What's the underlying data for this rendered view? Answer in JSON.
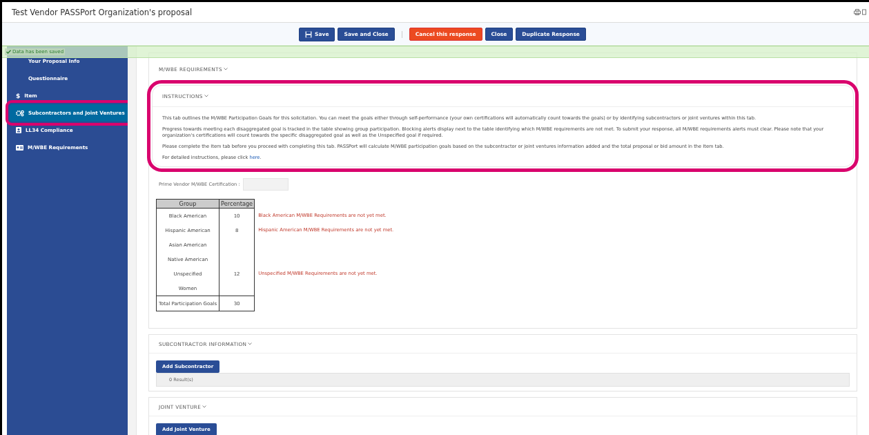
{
  "window": {
    "title": "Test Vendor PASSPort Organization's proposal"
  },
  "toolbar": {
    "buttons": [
      {
        "label": "Save",
        "kind": "primary"
      },
      {
        "label": "Save and Close",
        "kind": "primary"
      },
      {
        "kind": "separator"
      },
      {
        "label": "Cancel this response",
        "kind": "danger"
      },
      {
        "label": "Close",
        "kind": "primary"
      },
      {
        "label": "Duplicate Response",
        "kind": "primary"
      }
    ]
  },
  "status_banner": {
    "text": "Data has been saved"
  },
  "sidebar": {
    "items": [
      {
        "label": "Your Proposal Info",
        "selected": false,
        "highlighted": false
      },
      {
        "label": "Questionnaire",
        "selected": false,
        "highlighted": false
      },
      {
        "label": "Item",
        "glyph": "$",
        "selected": false,
        "highlighted": false
      },
      {
        "label": "Subcontractors and Joint Ventures",
        "selected": true,
        "highlighted": true
      },
      {
        "label": "LL34 Compliance",
        "selected": false,
        "highlighted": false
      },
      {
        "label": "M/WBE Requirements",
        "selected": false,
        "highlighted": false
      }
    ]
  },
  "mwbe_section": {
    "title": "M/WBE REQUIREMENTS",
    "instructions": {
      "title": "INSTRUCTIONS",
      "highlighted": true,
      "paragraphs": [
        "This tab outlines the M/WBE Participation Goals for this solicitation. You can meet the goals either through self-performance (your own certifications will automatically count towards the goals) or by identifying subcontractors or joint ventures within this tab.",
        "Progress towards meeting each disaggregated goal is tracked in the table showing group participation. Blocking alerts display next to the table identifying which M/WBE requirements are not met. To submit your response, all M/WBE requirements alerts must clear. Please note that your organization's certifications will count towards the specific disaggregated goal as well as the Unspecified goal if required.",
        "Please complete the Item tab before you proceed with completing this tab. PASSPort will calculate M/WBE participation goals based on the subcontractor or joint ventures information added and the total proposal or bid amount in the Item tab."
      ],
      "link_line": {
        "before": "For detailed instructions, please click ",
        "link": "here",
        "after": "."
      }
    },
    "prime_vendor": {
      "label": "Prime Vendor M/WBE Certification :"
    },
    "table": {
      "columns": [
        "Group",
        "Percentage"
      ],
      "rows": [
        {
          "group": "Black American",
          "percentage": "10",
          "alert": "Black American M/WBE Requirements are not yet met."
        },
        {
          "group": "Hispanic American",
          "percentage": "8",
          "alert": "Hispanic American M/WBE Requirements are not yet met."
        },
        {
          "group": "Asian American"
        },
        {
          "group": "Native American"
        },
        {
          "group": "Unspecified",
          "percentage": "12",
          "alert": "Unspecified M/WBE Requirements are not yet met."
        },
        {
          "group": "Women"
        }
      ],
      "total": {
        "label": "Total Participation Goals",
        "value": "30"
      }
    }
  },
  "subcontractor_section": {
    "title": "SUBCONTRACTOR INFORMATION",
    "button": "Add Subcontractor",
    "results": "0 Result(s)"
  },
  "joint_venture_section": {
    "title": "JOINT VENTURE",
    "button": "Add Joint Venture"
  }
}
